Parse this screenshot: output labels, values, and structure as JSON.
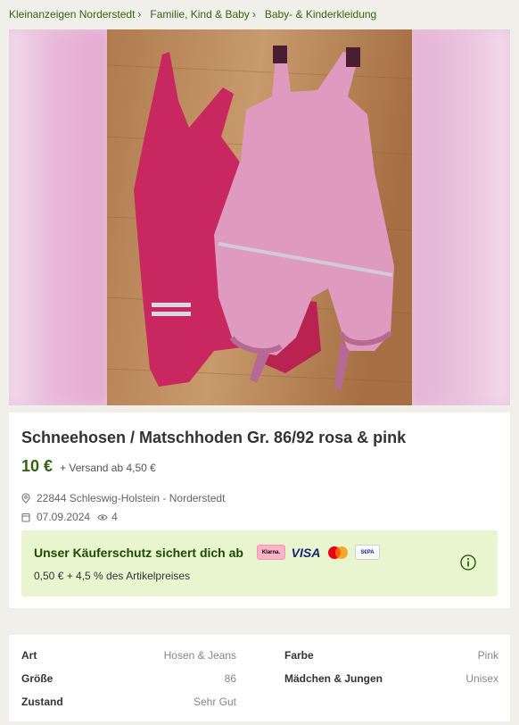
{
  "breadcrumb": [
    {
      "label": "Kleinanzeigen Norderstedt"
    },
    {
      "label": "Familie, Kind & Baby"
    },
    {
      "label": "Baby- & Kinderkleidung"
    }
  ],
  "listing": {
    "title": "Schneehosen / Matschhoden Gr. 86/92 rosa & pink",
    "price": "10 €",
    "shipping": "+ Versand ab 4,50 €",
    "location": "22844 Schleswig-Holstein - Norderstedt",
    "date": "07.09.2024",
    "views": "4"
  },
  "protection": {
    "title": "Unser Käuferschutz sichert dich ab",
    "fee": "0,50 € + 4,5 % des Artikelpreises",
    "payment_methods": {
      "klarna": "Klarna.",
      "visa": "VISA",
      "mastercard": "mastercard-logo",
      "sepa": "S€PA"
    }
  },
  "details": {
    "left": [
      {
        "label": "Art",
        "value": "Hosen & Jeans"
      },
      {
        "label": "Größe",
        "value": "86"
      },
      {
        "label": "Zustand",
        "value": "Sehr Gut"
      }
    ],
    "right": [
      {
        "label": "Farbe",
        "value": "Pink"
      },
      {
        "label": "Mädchen & Jungen",
        "value": "Unisex"
      }
    ]
  },
  "colors": {
    "brand_green": "#326314",
    "protection_bg": "#e8f5cf",
    "page_bg": "#f1efe9"
  }
}
